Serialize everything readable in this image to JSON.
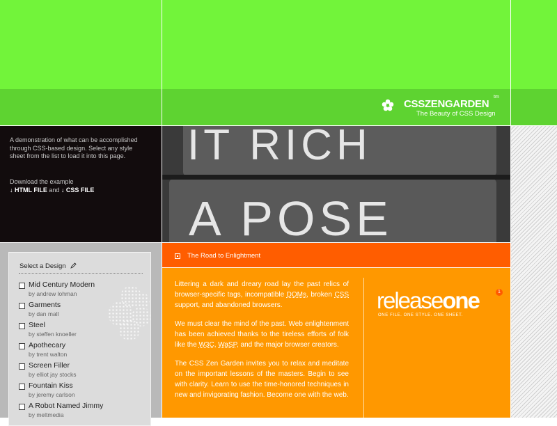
{
  "header": {
    "logo_title": "CSSZENGARDEN",
    "logo_tm": "tm",
    "logo_subtitle": "The Beauty of CSS Design"
  },
  "intro": {
    "text": "A demonstration of what can be accomplished through CSS-based design. Select any style sheet from the list to load it into this page.",
    "download_prefix": "Download the example",
    "html_link": "HTML FILE",
    "and_text": "and",
    "css_link": "CSS FILE",
    "download_arrow": "↓"
  },
  "photo": {
    "line1": "IT RICH",
    "line2": "A POSE"
  },
  "designs": {
    "title": "Select a Design",
    "items": [
      {
        "name": "Mid Century Modern",
        "author": "by andrew lohman"
      },
      {
        "name": "Garments",
        "author": "by dan mall"
      },
      {
        "name": "Steel",
        "author": "by steffen knoeller"
      },
      {
        "name": "Apothecary",
        "author": "by trent walton"
      },
      {
        "name": "Screen Filler",
        "author": "by elliot jay stocks"
      },
      {
        "name": "Fountain Kiss",
        "author": "by jeremy carlson"
      },
      {
        "name": "A Robot Named Jimmy",
        "author": "by meltmedia"
      }
    ]
  },
  "section": {
    "title": "The Road to Enlightment",
    "paragraphs": [
      {
        "parts": [
          "Littering a dark and dreary road lay the past relics of browser-specific tags, incompatible ",
          "DOMs",
          ", broken ",
          "CSS",
          " support, and abandoned browsers."
        ]
      },
      {
        "parts": [
          "We must clear the mind of the past. Web enlightenment has been achieved thanks to the tireless efforts of folk like the ",
          "W3C",
          ", ",
          "WaSP",
          ", and the major browser creators."
        ]
      },
      {
        "parts": [
          "The CSS Zen Garden invites you to relax and meditate on the important lessons of the masters. Begin to see with clarity. Learn to use the time-honored techniques in new and invigorating fashion. Become one with the web."
        ]
      }
    ]
  },
  "release": {
    "light": "release",
    "bold": "one",
    "badge": "1",
    "tagline": "ONE FILE. ONE STYLE. ONE SHEET."
  },
  "colors": {
    "green": "#72f43a",
    "dark_green": "#5ed331",
    "orange": "#ff9800",
    "red_orange": "#ff5d00",
    "black": "#120c0d"
  },
  "icons": [
    "flower-icon",
    "download-arrow-icon",
    "pencil-icon",
    "checkbox-icon",
    "bullet-square-icon"
  ]
}
